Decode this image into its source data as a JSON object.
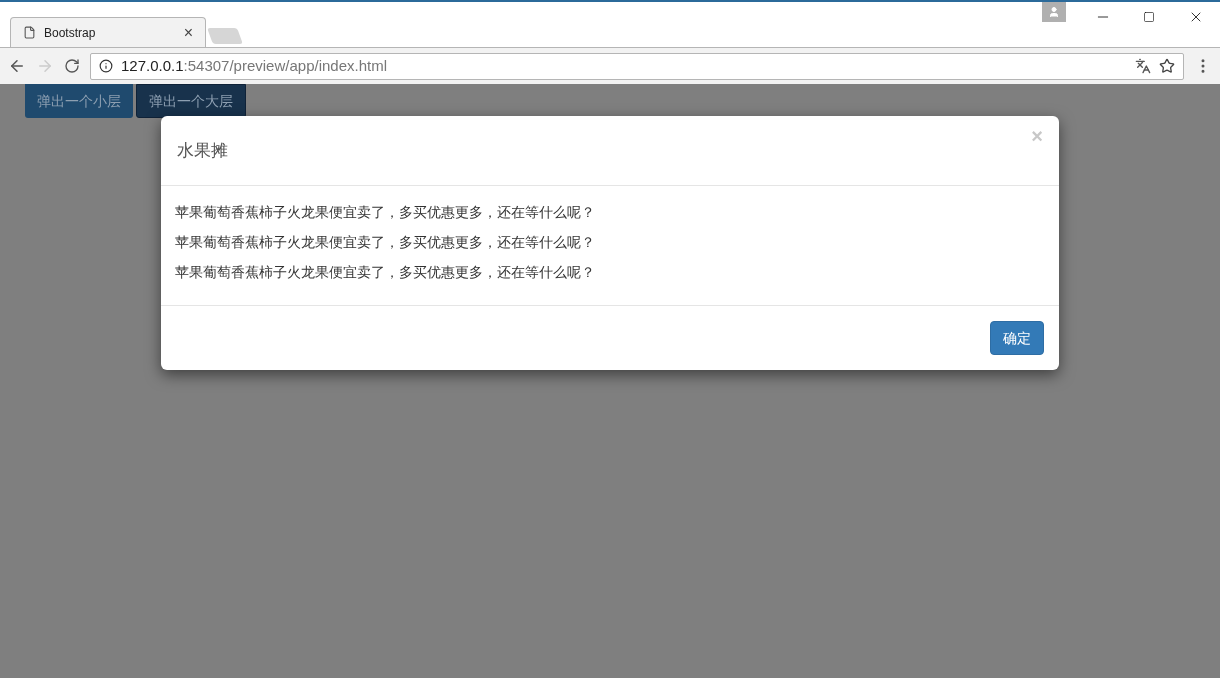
{
  "browser": {
    "tab": {
      "title": "Bootstrap",
      "close": "×"
    },
    "address": {
      "host": "127.0.0.1",
      "path": ":54307/preview/app/index.html"
    }
  },
  "page": {
    "buttons": [
      {
        "label": "弹出一个小层",
        "active": false
      },
      {
        "label": "弹出一个大层",
        "active": true
      }
    ]
  },
  "modal": {
    "title": "水果摊",
    "close": "×",
    "lines": [
      "苹果葡萄香蕉柿子火龙果便宜卖了，多买优惠更多，还在等什么呢？",
      "苹果葡萄香蕉柿子火龙果便宜卖了，多买优惠更多，还在等什么呢？",
      "苹果葡萄香蕉柿子火龙果便宜卖了，多买优惠更多，还在等什么呢？"
    ],
    "buttons": [
      "确定"
    ]
  }
}
